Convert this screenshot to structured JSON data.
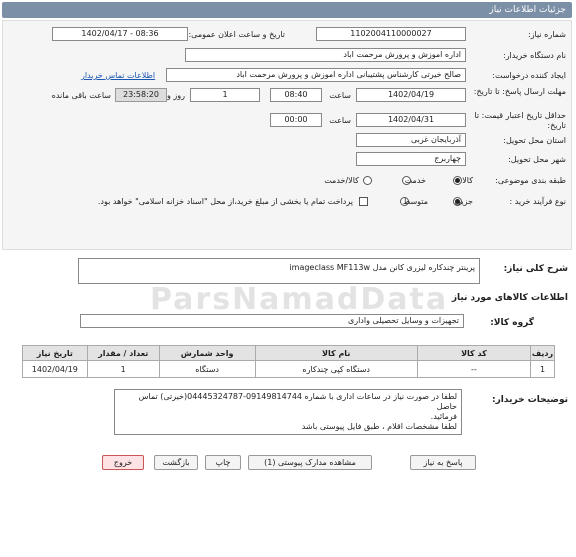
{
  "header": {
    "title": "جزئیات اطلاعات نیاز"
  },
  "form": {
    "need_number_label": "شماره نیاز:",
    "need_number": "1102004110000027",
    "announce_label": "تاریخ و ساعت اعلان عمومی:",
    "announce_value": "1402/04/17 - 08:36",
    "buyer_org_label": "نام دستگاه خریدار:",
    "buyer_org": "اداره اموزش و پرورش مرحمت اباد",
    "creator_label": "ایجاد کننده درخواست:",
    "creator": "صالح خیرتی کارشناس پشتیبانی  اداره اموزش و پرورش مرحمت اباد",
    "contact_link": "اطلاعات تماس خریدار",
    "deadline_label": "مهلت ارسال پاسخ: تا تاریخ:",
    "deadline_date": "1402/04/19",
    "time_label": "ساعت",
    "deadline_time": "08:40",
    "days": "1",
    "days_label": "روز و",
    "remaining": "23:58:20",
    "remaining_label": "ساعت باقی مانده",
    "validity_label": "حداقل تاریخ اعتبار قیمت: تا تاریخ:",
    "validity_date": "1402/04/31",
    "time_label2": "ساعت",
    "validity_time": "00:00",
    "province_label": "استان محل تحویل:",
    "province": "آذربایجان غربی",
    "city_label": "شهر محل تحویل:",
    "city": "چهاربرج",
    "category_label": "طبقه بندی موضوعی:",
    "cat_goods": "کالا",
    "cat_service": "خدمت",
    "cat_both": "کالا/خدمت",
    "process_label": "نوع فرآیند خرید :",
    "proc_partial": "جزیی",
    "proc_medium": "متوسط",
    "payment_note": "پرداخت تمام یا بخشی از مبلغ خرید،از محل \"اسناد خزانه اسلامی\" خواهد بود."
  },
  "need": {
    "desc_label": "شرح کلی نیاز:",
    "desc": "پرینتر چندکاره لیزری کانن مدل imageclass MF113w",
    "goods_info_title": "اطلاعات کالاهای مورد نیاز",
    "group_label": "گروه کالا:",
    "group": "تجهیزات و وسایل تحصیلی واداری"
  },
  "table": {
    "headers": [
      "ردیف",
      "کد کالا",
      "نام کالا",
      "واحد شمارش",
      "تعداد / مقدار",
      "تاریخ نیاز"
    ],
    "rows": [
      {
        "row": "1",
        "code": "--",
        "name": "دستگاه کپی چندکاره",
        "unit": "دستگاه",
        "qty": "1",
        "date": "1402/04/19"
      }
    ]
  },
  "buyer_notes": {
    "label": "توضیحات خریدار:",
    "line1": "لطفا در صورت نیاز در ساعات اداری با شماره 09149814744-04445324787(خیرتی) تماس حاصل",
    "line2": "فرمائید.",
    "line3": "لطفا مشخصات اقلام ، طبق فایل پیوستی باشد"
  },
  "buttons": {
    "reply": "پاسخ به نیاز",
    "view_docs": "مشاهده مدارک پیوستی (1)",
    "print": "چاپ",
    "back": "بازگشت",
    "exit": "خروج"
  },
  "watermark": {
    "brand": "ParsNamadData"
  },
  "colors": {
    "header_bg": "#7b8fa6",
    "link": "#1a57b4",
    "exit_btn": "#fde3e3"
  }
}
